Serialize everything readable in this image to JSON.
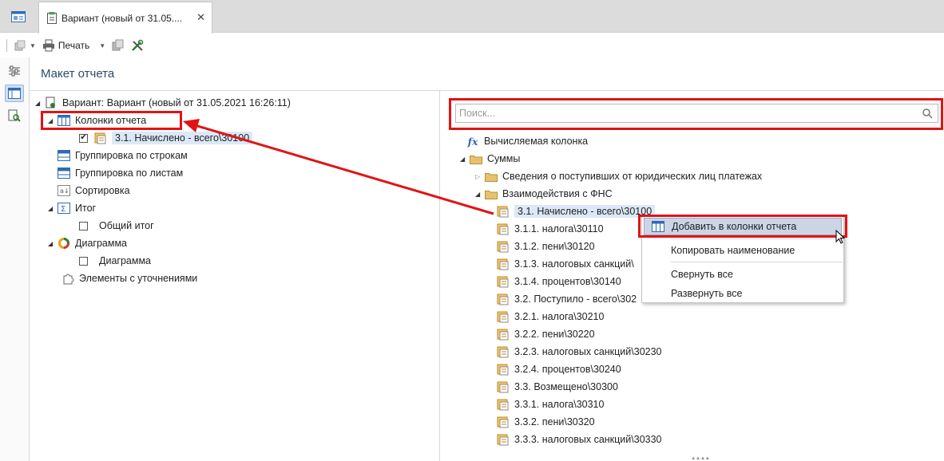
{
  "tab": {
    "title": "Вариант (новый от 31.05....",
    "close": "✕"
  },
  "toolbar": {
    "print_label": "Печать"
  },
  "page_title": "Макет отчета",
  "left_tree": {
    "root": "Вариант: Вариант (новый от 31.05.2021 16:26:11)",
    "columns": "Колонки отчета",
    "column_item": "3.1. Начислено - всего\\30100",
    "group_rows": "Группировка по строкам",
    "group_sheets": "Группировка по листам",
    "sort": "Сортировка",
    "total": "Итог",
    "total_child": "Общий итог",
    "chart": "Диаграмма",
    "chart_child": "Диаграмма",
    "refinements": "Элементы с уточнениями"
  },
  "search": {
    "placeholder": "Поиск..."
  },
  "right_tree": {
    "calc_column": "Вычисляемая колонка",
    "sums": "Суммы",
    "folder1": "Сведения о поступивших от юридических лиц платежах",
    "folder2": "Взаимодействия с ФНС",
    "items": [
      "3.1. Начислено - всего\\30100",
      "3.1.1. налога\\30110",
      "3.1.2. пени\\30120",
      "3.1.3. налоговых санкций\\",
      "3.1.4. процентов\\30140",
      "3.2. Поступило - всего\\302",
      "3.2.1. налога\\30210",
      "3.2.2. пени\\30220",
      "3.2.3. налоговых санкций\\30230",
      "3.2.4. процентов\\30240",
      "3.3. Возмещено\\30300",
      "3.3.1. налога\\30310",
      "3.3.2. пени\\30320",
      "3.3.3. налоговых санкций\\30330"
    ]
  },
  "context_menu": {
    "add": "Добавить в колонки отчета",
    "copy": "Копировать наименование",
    "collapse": "Свернуть все",
    "expand": "Развернуть все"
  },
  "colors": {
    "highlight": "#e11414",
    "selection": "#dbe8f7",
    "title": "#2d4a6b"
  }
}
